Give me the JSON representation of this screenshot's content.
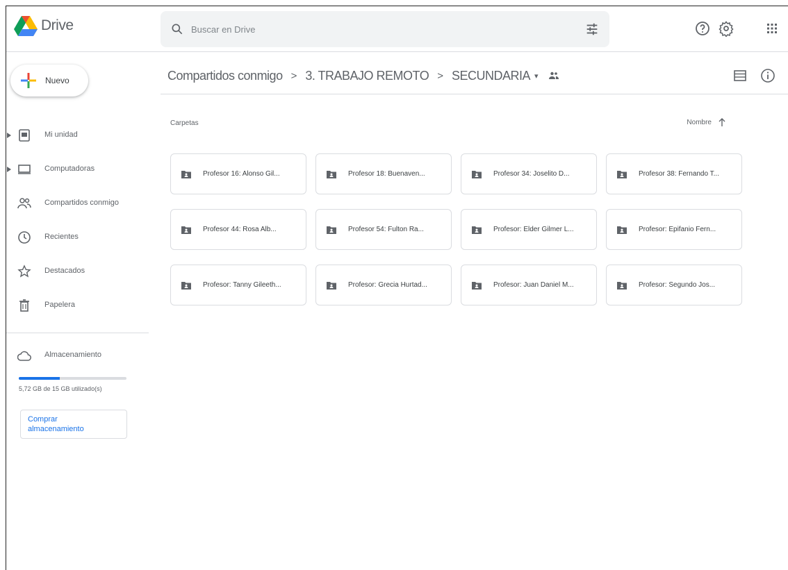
{
  "app": {
    "name": "Drive"
  },
  "search": {
    "placeholder": "Buscar en Drive"
  },
  "header": {
    "icons": [
      "help-icon",
      "settings-icon",
      "apps-grid-icon"
    ]
  },
  "sidebar": {
    "new_label": "Nuevo",
    "items": [
      {
        "label": "Mi unidad",
        "icon": "my-drive-icon",
        "expandable": true
      },
      {
        "label": "Computadoras",
        "icon": "computers-icon",
        "expandable": true
      },
      {
        "label": "Compartidos conmigo",
        "icon": "shared-with-me-icon",
        "expandable": false
      },
      {
        "label": "Recientes",
        "icon": "recent-icon",
        "expandable": false
      },
      {
        "label": "Destacados",
        "icon": "starred-icon",
        "expandable": false
      },
      {
        "label": "Papelera",
        "icon": "trash-icon",
        "expandable": false
      }
    ],
    "storage": {
      "label": "Almacenamiento",
      "usage_text": "5,72 GB de 15 GB utilizado(s)",
      "used_fraction": 0.38,
      "buy_label_line1": "Comprar",
      "buy_label_line2": "almacenamiento"
    }
  },
  "breadcrumb": {
    "items": [
      "Compartidos conmigo",
      "3. TRABAJO REMOTO",
      "SECUNDARIA"
    ],
    "separator": ">",
    "dropdown_glyph": "▾"
  },
  "main": {
    "section_label": "Carpetas",
    "sort_label": "Nombre",
    "folders": [
      "Profesor 16: Alonso Gil...",
      "Profesor 18: Buenaven...",
      "Profesor 34: Joselito D...",
      "Profesor 38: Fernando T...",
      "Profesor 44: Rosa Alb...",
      "Profesor 54: Fulton Ra...",
      "Profesor: Elder Gilmer L...",
      "Profesor: Epifanio Fern...",
      "Profesor: Tanny Gileeth...",
      "Profesor: Grecia Hurtad...",
      "Profesor: Juan Daniel M...",
      "Profesor: Segundo Jos..."
    ]
  },
  "colors": {
    "accent": "#1a73e8",
    "text": "#5f6368",
    "border": "#dadce0",
    "search_bg": "#f1f3f4"
  }
}
